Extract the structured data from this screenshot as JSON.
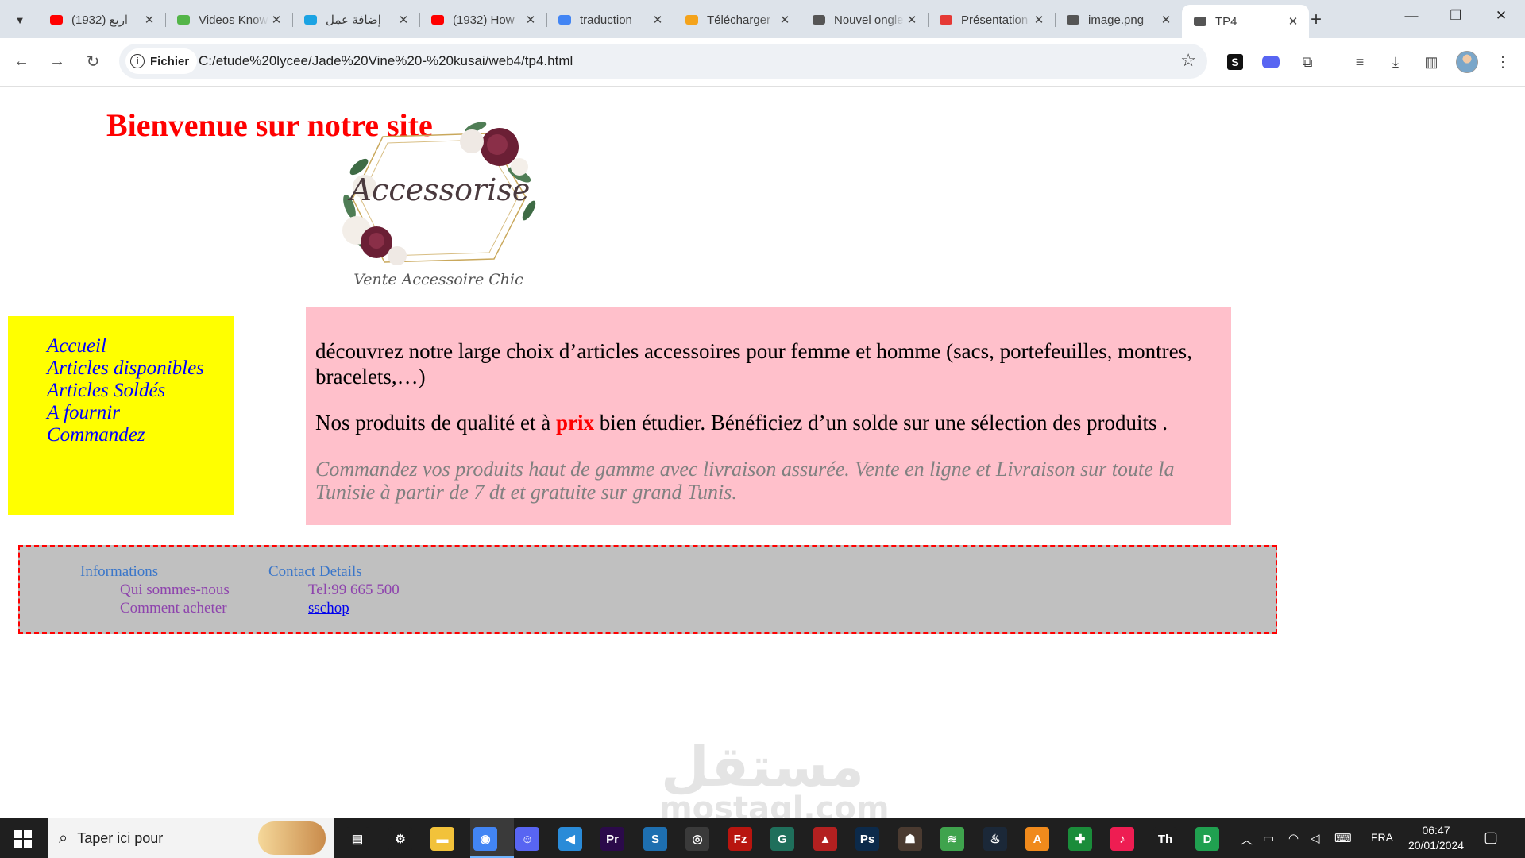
{
  "browser": {
    "tabs": [
      {
        "title": "(1932) اربع",
        "icon": "youtube-icon",
        "color": "#ff0000"
      },
      {
        "title": "Videos Knowledge",
        "icon": "leaf-icon",
        "color": "#53b548"
      },
      {
        "title": "إضافة عمل",
        "icon": "circle-icon",
        "color": "#1ba3e3"
      },
      {
        "title": "(1932) How",
        "icon": "youtube-icon",
        "color": "#ff0000"
      },
      {
        "title": "traduction",
        "icon": "google-icon",
        "color": "#4285f4"
      },
      {
        "title": "Télécharger",
        "icon": "download-site-icon",
        "color": "#f4a31b"
      },
      {
        "title": "Nouvel onglet",
        "icon": "chrome-icon",
        "color": "#555555"
      },
      {
        "title": "Présentation",
        "icon": "red-logo-icon",
        "color": "#e53935"
      },
      {
        "title": "image.png",
        "icon": "globe-icon",
        "color": "#555555"
      },
      {
        "title": "TP4",
        "icon": "page-icon",
        "color": "#555555",
        "active": true
      }
    ],
    "new_tab": "+",
    "address": {
      "chip_label": "Fichier",
      "url": "C:/etude%20lycee/Jade%20Vine%20-%20kusai/web4/tp4.html"
    }
  },
  "page": {
    "title": "Bienvenue sur notre site",
    "logo": {
      "brand": "Accessorise",
      "tagline": "Vente Accessoire Chic"
    },
    "menu": [
      "Accueil",
      "Articles disponibles",
      "Articles Soldés",
      "A fournir",
      "Commandez"
    ],
    "content": {
      "p1": "découvrez notre large choix d’articles accessoires pour femme et homme (sacs, portefeuilles, montres, bracelets,…)",
      "p2_before": "Nos produits de qualité et à ",
      "p2_highlight": "prix",
      "p2_after": " bien étudier. Bénéficiez d’un solde sur une sélection des produits .",
      "p3": "Commandez vos produits haut de gamme avec livraison assurée. Vente en ligne et Livraison sur toute la Tunisie à partir de 7 dt et gratuite sur grand Tunis."
    },
    "footer": {
      "col1": {
        "heading": "Informations",
        "items": [
          "Qui sommes-nous",
          "Comment acheter"
        ]
      },
      "col2": {
        "heading": "Contact Details",
        "phone": "Tel:99 665 500",
        "link": "sschop"
      }
    },
    "watermark": {
      "line1": "مستقل",
      "line2": "mostaql.com"
    }
  },
  "taskbar": {
    "search_placeholder": "Taper ici pour",
    "apps": [
      "task-view",
      "settings",
      "file-explorer",
      "chrome",
      "discord",
      "vscode",
      "premiere",
      "sketchup",
      "obs",
      "filezilla",
      "git",
      "red-app",
      "photoshop",
      "portrait-app",
      "stack-app",
      "steam",
      "orange-app",
      "green-app",
      "tiktok",
      "font-app",
      "d-app"
    ],
    "lang": "FRA",
    "time": "06:47",
    "date": "20/01/2024"
  }
}
